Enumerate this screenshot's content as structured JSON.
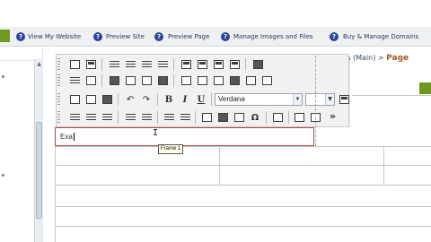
{
  "topnav": {
    "green_button_label": "",
    "items": [
      {
        "label": "View My Website",
        "help": "?"
      },
      {
        "label": "Preview Site",
        "help": "?"
      },
      {
        "label": "Preview Page",
        "help": "?"
      },
      {
        "label": "Manage Images and Files",
        "help": "?"
      },
      {
        "label": "Buy & Manage Domains",
        "help": "?"
      }
    ]
  },
  "breadcrumb": {
    "prefix": "A (Main) >",
    "current": "Page"
  },
  "toolbar": {
    "font_name": "Verdana",
    "font_size": "",
    "dropdown_glyph": "▼",
    "more_glyph": "»",
    "bold_label": "B",
    "italic_label": "I",
    "underline_label": "U",
    "undo_glyph": "↶",
    "redo_glyph": "↷",
    "special_char_glyph": "Ω"
  },
  "editor": {
    "frame_text": "Exa",
    "tooltip": "Frame 1",
    "cursor_glyph": "I"
  },
  "leftscroll": {
    "up_arrow": "▲"
  },
  "colors": {
    "accent_green": "#6f9a1f",
    "help_blue": "#27459a",
    "breadcrumb_orange": "#a55a1f",
    "frame_border_red": "#b74a4a"
  }
}
